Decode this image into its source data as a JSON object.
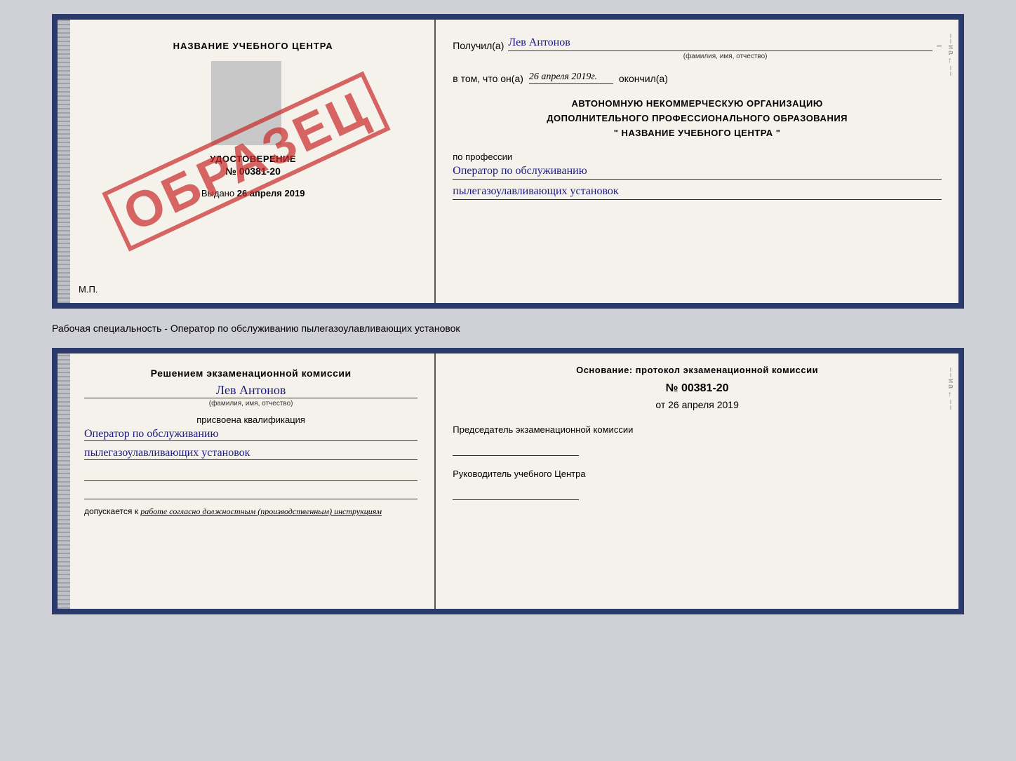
{
  "certificate": {
    "top": {
      "left": {
        "school_name": "НАЗВАНИЕ УЧЕБНОГО ЦЕНТРА",
        "udostoverenie": "УДОСТОВЕРЕНИЕ",
        "number": "№ 00381-20",
        "vydano_label": "Выдано",
        "vydano_date": "26 апреля 2019",
        "mp_label": "М.П.",
        "obrazec": "ОБРАЗЕЦ"
      },
      "right": {
        "poluchil_label": "Получил(а)",
        "poluchil_name": "Лев Антонов",
        "fio_sub": "(фамилия, имя, отчество)",
        "vtom_label": "в том, что он(а)",
        "vtom_date": "26 апреля 2019г.",
        "okonchil_label": "окончил(а)",
        "org_line1": "АВТОНОМНУЮ НЕКОММЕРЧЕСКУЮ ОРГАНИЗАЦИЮ",
        "org_line2": "ДОПОЛНИТЕЛЬНОГО ПРОФЕССИОНАЛЬНОГО ОБРАЗОВАНИЯ",
        "org_quote": "\"  НАЗВАНИЕ УЧЕБНОГО ЦЕНТРА  \"",
        "po_professii": "по профессии",
        "profession1": "Оператор по обслуживанию",
        "profession2": "пылегазоулавливающих установок"
      }
    },
    "middle_text": "Рабочая специальность - Оператор по обслуживанию пылегазоулавливающих установок",
    "bottom": {
      "left": {
        "resheniem_title": "Решением экзаменационной комиссии",
        "person_name": "Лев Антонов",
        "fio_sub": "(фамилия, имя, отчество)",
        "prisvoena_label": "присвоена квалификация",
        "qualification1": "Оператор по обслуживанию",
        "qualification2": "пылегазоулавливающих установок",
        "dopuskaetsya_label": "допускается к",
        "dopuskaetsya_value": "работе согласно должностным (производственным) инструкциям"
      },
      "right": {
        "osnovanie_label": "Основание: протокол экзаменационной комиссии",
        "protocol_num": "№  00381-20",
        "ot_label": "от",
        "ot_date": "26 апреля 2019",
        "predsedatel_label": "Председатель экзаменационной комиссии",
        "rukovoditel_label": "Руководитель учебного Центра"
      }
    }
  },
  "side_chars": {
    "top_right": [
      "и",
      "а",
      "←",
      "–",
      "–",
      "–",
      "–"
    ],
    "bottom_right": [
      "и",
      "а",
      "←",
      "–",
      "–",
      "–",
      "–"
    ]
  }
}
